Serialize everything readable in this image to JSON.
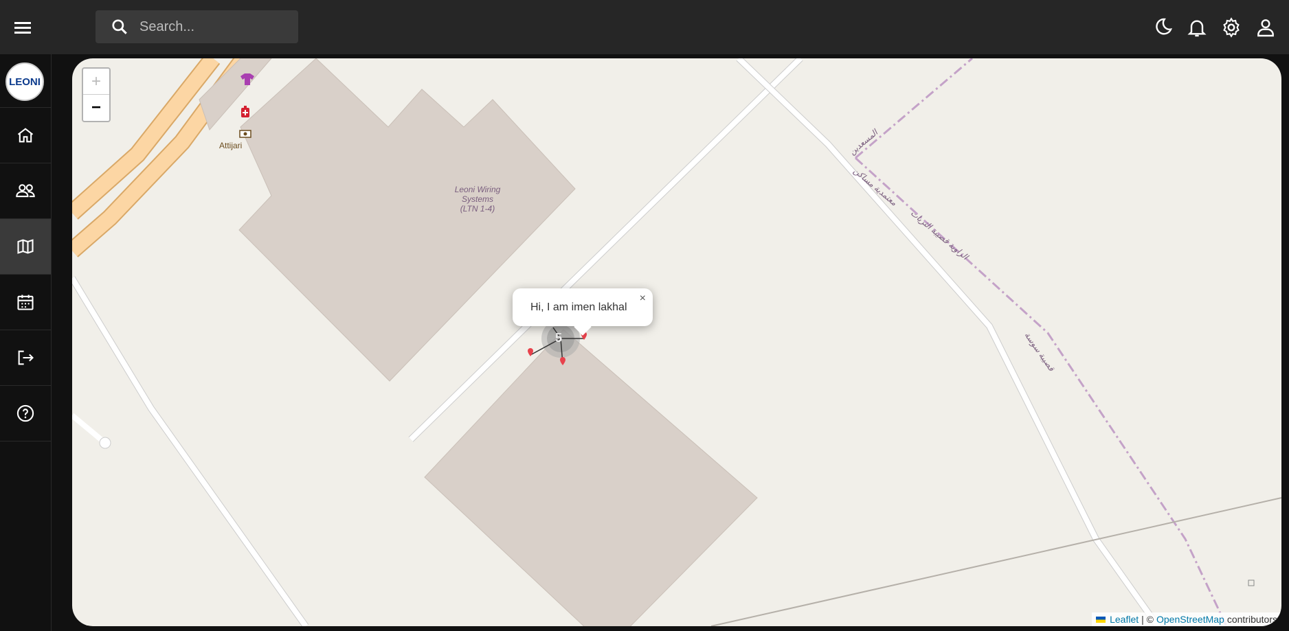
{
  "header": {
    "search_placeholder": "Search..."
  },
  "sidebar": {
    "logo_text": "LEONI",
    "items": [
      {
        "icon": "home-icon"
      },
      {
        "icon": "users-icon"
      },
      {
        "icon": "map-icon",
        "active": true
      },
      {
        "icon": "calendar-icon"
      },
      {
        "icon": "logout-icon"
      },
      {
        "icon": "help-icon"
      }
    ]
  },
  "map": {
    "zoom_in": "+",
    "zoom_out": "−",
    "building_label": [
      "Leoni Wiring",
      "Systems",
      "(LTN 1-4)"
    ],
    "poi_label": "Attijari",
    "street_labels": [
      "المسعدين",
      "معتمدية مساكن",
      "الزاوية قصيبة الثريات",
      "قصيبة سوسة"
    ],
    "cluster_count": "5",
    "popup": {
      "text": "Hi, I am imen lakhal",
      "close": "×"
    },
    "attribution": {
      "leaflet": "Leaflet",
      "sep": "| ©",
      "osm": "OpenStreetMap",
      "suffix": "contributors"
    }
  },
  "colors": {
    "topbar": "#262626",
    "sidebar": "#111111",
    "map_bg": "#f1efe9",
    "building": "#d9d0c9",
    "road_major": "#fcd6a4",
    "marker": "#e8424c"
  }
}
